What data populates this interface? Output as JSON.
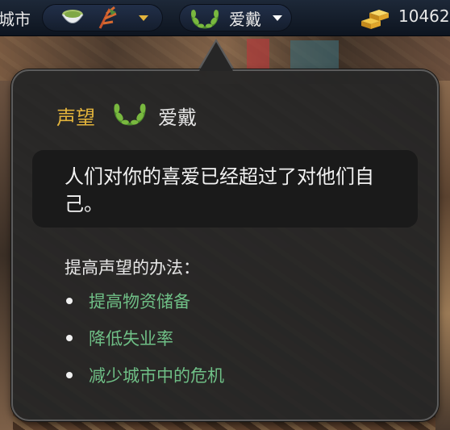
{
  "topbar": {
    "city_label": "城市",
    "reputation_name": "爱戴",
    "gold_amount": "10462",
    "icons": [
      "tea-bowl-icon",
      "herb-icon",
      "laurel-wreath-icon",
      "gold-bars-icon"
    ]
  },
  "tooltip": {
    "title": "声望",
    "level_name": "爱戴",
    "description": "人们对你的喜爱已经超过了对他们自己。",
    "ways_title": "提高声望的办法：",
    "ways": [
      {
        "label": "提高物资储备"
      },
      {
        "label": "降低失业率"
      },
      {
        "label": "减少城市中的危机"
      }
    ]
  },
  "colors": {
    "title": "#e3b43c",
    "way_link": "#6fbf86",
    "panel": "#262626"
  }
}
